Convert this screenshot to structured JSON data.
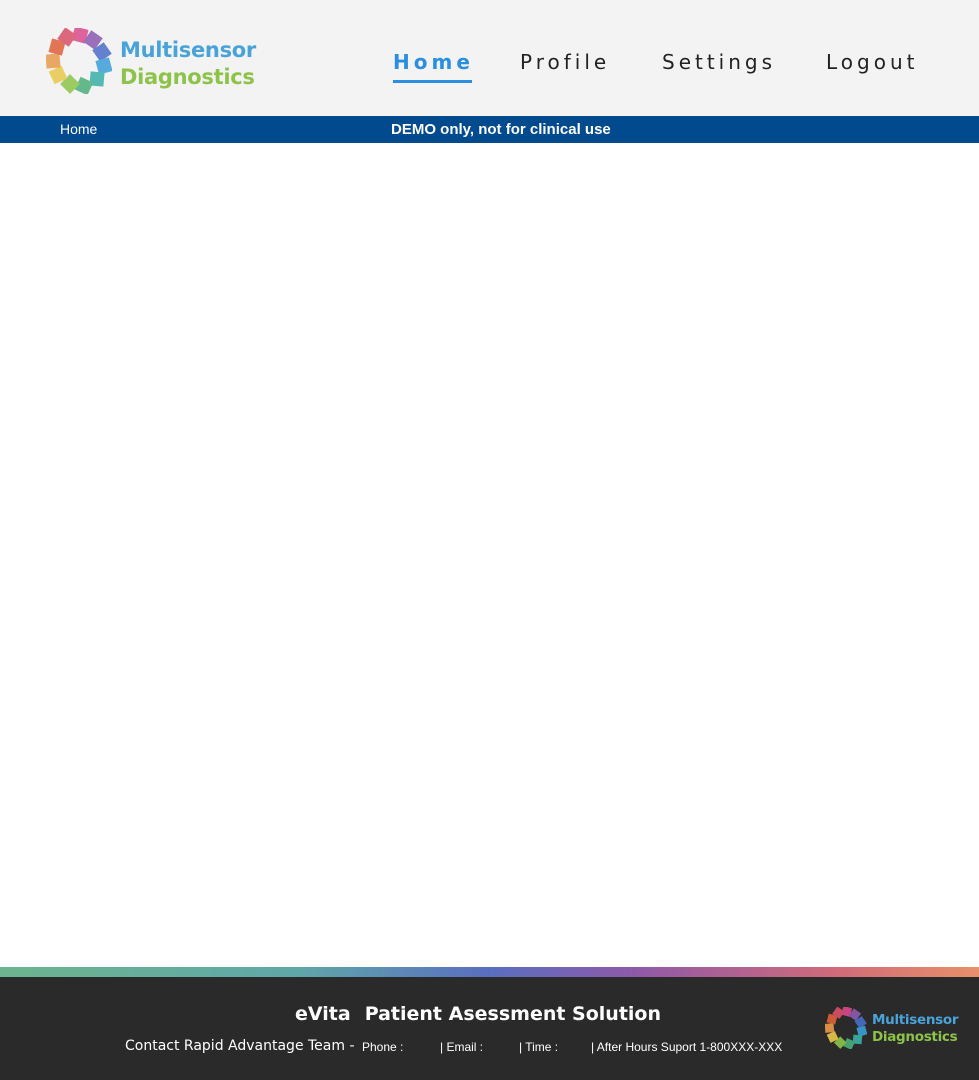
{
  "header": {
    "logo": {
      "line1": "Multisensor",
      "line2": "Diagnostics",
      "icon": "multisensor-flower-logo"
    },
    "nav": [
      {
        "label": "Home",
        "active": true
      },
      {
        "label": "Profile",
        "active": false
      },
      {
        "label": "Settings",
        "active": false
      },
      {
        "label": "Logout",
        "active": false
      }
    ]
  },
  "subbar": {
    "breadcrumb": "Home",
    "notice": "DEMO only, not for clinical use"
  },
  "footer": {
    "product": "eVita",
    "title": "Patient Asessment Solution",
    "contact_label": "Contact Rapid Advantage Team -",
    "phone_label": "Phone :",
    "email_label": "| Email :",
    "time_label": "| Time :",
    "after_hours": "| After Hours Suport 1-800XXX-XXX",
    "logo": {
      "line1": "Multisensor",
      "line2": "Diagnostics"
    }
  },
  "colors": {
    "accent": "#2a8fe0",
    "bar": "#004a8d",
    "footer_bg": "#2a2a2a",
    "logo_blue": "#4aa3d8",
    "logo_green": "#8dc34a"
  }
}
